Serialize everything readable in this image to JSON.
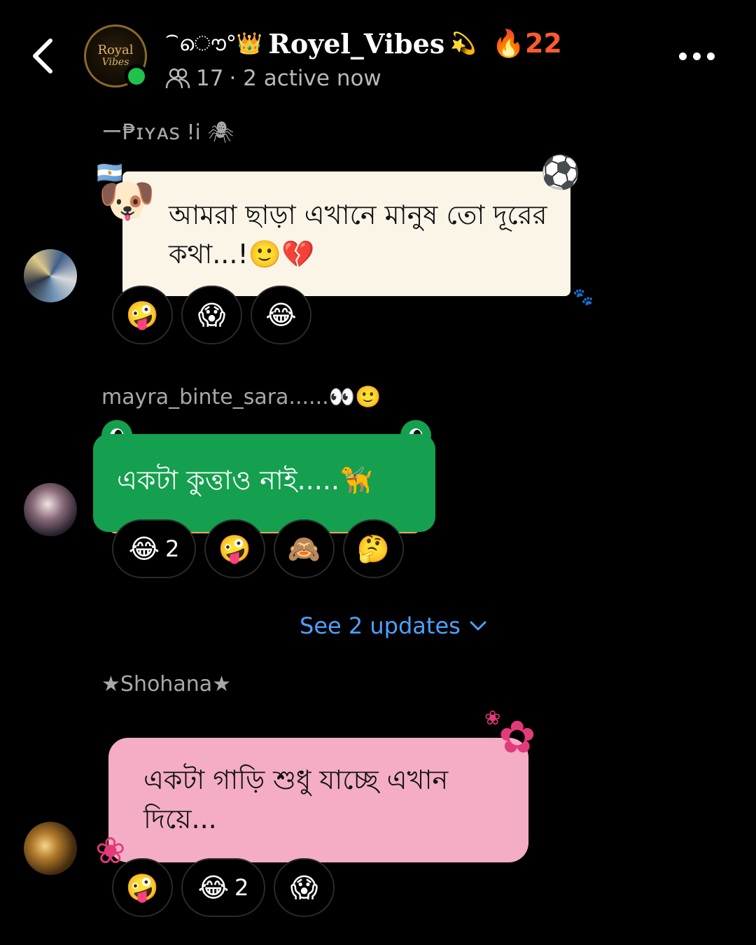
{
  "header": {
    "group_name_prefix": "⁀ൌ°👑",
    "group_name": "Royel_Vibes",
    "group_name_suffix": "💫",
    "streak_icon": "🔥",
    "streak_count": "22",
    "member_count": "17",
    "active_text": "· 2 active now",
    "avatar_text_1": "Royal",
    "avatar_text_2": "Vibes"
  },
  "messages": [
    {
      "sender": "ー₱ɪʏᴀs  !i 🕷",
      "text": "আমরা ছাড়া এখানে মানুষ তো দূরের কথা...!🙂💔",
      "reactions": [
        {
          "emoji": "🤪",
          "count": ""
        },
        {
          "emoji": "😱",
          "count": ""
        },
        {
          "emoji": "😂",
          "count": ""
        }
      ]
    },
    {
      "sender": "mayra_binte_sara......👀🙂",
      "text": "একটা কুত্তাও নাই.....🦮",
      "reactions": [
        {
          "emoji": "😂",
          "count": "2"
        },
        {
          "emoji": "🤪",
          "count": ""
        },
        {
          "emoji": "🙈",
          "count": ""
        },
        {
          "emoji": "🤔",
          "count": ""
        }
      ]
    },
    {
      "sender": "★Shohana★",
      "text": "একটা গাড়ি শুধু যাচ্ছে এখান দিয়ে...",
      "reactions": [
        {
          "emoji": "🤪",
          "count": ""
        },
        {
          "emoji": "😂",
          "count": "2"
        },
        {
          "emoji": "😱",
          "count": ""
        }
      ]
    }
  ],
  "updates": {
    "label": "See 2 updates"
  },
  "stickers": {
    "dog": "🐶",
    "flag": "🇦🇷",
    "ball": "⚽",
    "paw": "🐾"
  },
  "colors": {
    "background": "#000000",
    "bubble_cream": "#fbf5e8",
    "bubble_green": "#14a04e",
    "bubble_pink": "#f4adc5",
    "link_blue": "#4ea0ff",
    "online_green": "#1fc24a",
    "streak_orange": "#ff5b2e"
  }
}
